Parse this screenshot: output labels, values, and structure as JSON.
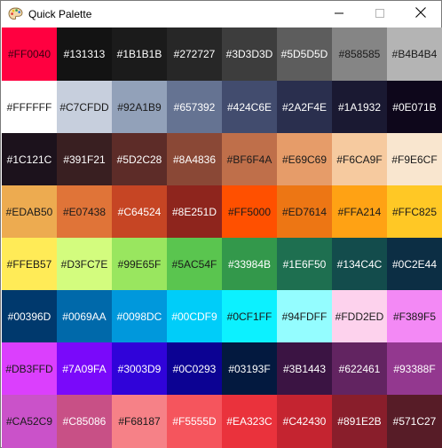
{
  "window": {
    "title": "Quick Palette",
    "app_icon": "palette-icon",
    "controls": [
      "minimize-icon",
      "maximize-icon",
      "close-icon"
    ]
  },
  "palette": {
    "swatches": [
      {
        "label": "#FF0040",
        "color": "#FF0040",
        "text": "#3a0010"
      },
      {
        "label": "#131313",
        "color": "#131313",
        "text": "#ffffff"
      },
      {
        "label": "#1B1B1B",
        "color": "#1B1B1B",
        "text": "#ffffff"
      },
      {
        "label": "#272727",
        "color": "#272727",
        "text": "#ffffff"
      },
      {
        "label": "#3D3D3D",
        "color": "#3D3D3D",
        "text": "#ffffff"
      },
      {
        "label": "#5D5D5D",
        "color": "#5D5D5D",
        "text": "#ffffff"
      },
      {
        "label": "#858585",
        "color": "#858585",
        "text": "#1a1a1a"
      },
      {
        "label": "#B4B4B4",
        "color": "#B4B4B4",
        "text": "#1a1a1a"
      },
      {
        "label": "#FFFFFF",
        "color": "#FFFFFF",
        "text": "#1a1a1a"
      },
      {
        "label": "#C7CFDD",
        "color": "#C7CFDD",
        "text": "#1a1a1a"
      },
      {
        "label": "#92A1B9",
        "color": "#92A1B9",
        "text": "#1a1a1a"
      },
      {
        "label": "#657392",
        "color": "#657392",
        "text": "#ffffff"
      },
      {
        "label": "#424C6E",
        "color": "#424C6E",
        "text": "#ffffff"
      },
      {
        "label": "#2A2F4E",
        "color": "#2A2F4E",
        "text": "#ffffff"
      },
      {
        "label": "#1A1932",
        "color": "#1A1932",
        "text": "#ffffff"
      },
      {
        "label": "#0E071B",
        "color": "#0E071B",
        "text": "#ffffff"
      },
      {
        "label": "#1C121C",
        "color": "#1C121C",
        "text": "#ffffff"
      },
      {
        "label": "#391F21",
        "color": "#391F21",
        "text": "#ffffff"
      },
      {
        "label": "#5D2C28",
        "color": "#5D2C28",
        "text": "#ffffff"
      },
      {
        "label": "#8A4836",
        "color": "#8A4836",
        "text": "#ffffff"
      },
      {
        "label": "#BF6F4A",
        "color": "#BF6F4A",
        "text": "#1a1a1a"
      },
      {
        "label": "#E69C69",
        "color": "#E69C69",
        "text": "#1a1a1a"
      },
      {
        "label": "#F6CA9F",
        "color": "#F6CA9F",
        "text": "#1a1a1a"
      },
      {
        "label": "#F9E6CF",
        "color": "#F9E6CF",
        "text": "#1a1a1a"
      },
      {
        "label": "#EDAB50",
        "color": "#EDAB50",
        "text": "#1a1a1a"
      },
      {
        "label": "#E07438",
        "color": "#E07438",
        "text": "#1a1a1a"
      },
      {
        "label": "#C64524",
        "color": "#C64524",
        "text": "#ffffff"
      },
      {
        "label": "#8E251D",
        "color": "#8E251D",
        "text": "#ffffff"
      },
      {
        "label": "#FF5000",
        "color": "#FF5000",
        "text": "#1a1a1a"
      },
      {
        "label": "#ED7614",
        "color": "#ED7614",
        "text": "#1a1a1a"
      },
      {
        "label": "#FFA214",
        "color": "#FFA214",
        "text": "#1a1a1a"
      },
      {
        "label": "#FFC825",
        "color": "#FFC825",
        "text": "#1a1a1a"
      },
      {
        "label": "#FFEB57",
        "color": "#FFEB57",
        "text": "#1a1a1a"
      },
      {
        "label": "#D3FC7E",
        "color": "#D3FC7E",
        "text": "#1a1a1a"
      },
      {
        "label": "#99E65F",
        "color": "#99E65F",
        "text": "#1a1a1a"
      },
      {
        "label": "#5AC54F",
        "color": "#5AC54F",
        "text": "#1a1a1a"
      },
      {
        "label": "#33984B",
        "color": "#33984B",
        "text": "#ffffff"
      },
      {
        "label": "#1E6F50",
        "color": "#1E6F50",
        "text": "#ffffff"
      },
      {
        "label": "#134C4C",
        "color": "#134C4C",
        "text": "#ffffff"
      },
      {
        "label": "#0C2E44",
        "color": "#0C2E44",
        "text": "#ffffff"
      },
      {
        "label": "#00396D",
        "color": "#00396D",
        "text": "#ffffff"
      },
      {
        "label": "#0069AA",
        "color": "#0069AA",
        "text": "#ffffff"
      },
      {
        "label": "#0098DC",
        "color": "#0098DC",
        "text": "#ffffff"
      },
      {
        "label": "#00CDF9",
        "color": "#00CDF9",
        "text": "#ffffff"
      },
      {
        "label": "#0CF1FF",
        "color": "#0CF1FF",
        "text": "#1a1a1a"
      },
      {
        "label": "#94FDFF",
        "color": "#94FDFF",
        "text": "#1a1a1a"
      },
      {
        "label": "#FDD2ED",
        "color": "#FDD2ED",
        "text": "#1a1a1a"
      },
      {
        "label": "#F389F5",
        "color": "#F389F5",
        "text": "#1a1a1a"
      },
      {
        "label": "#DB3FFD",
        "color": "#DB3FFD",
        "text": "#1a1a1a"
      },
      {
        "label": "#7A09FA",
        "color": "#7A09FA",
        "text": "#ffffff"
      },
      {
        "label": "#3003D9",
        "color": "#3003D9",
        "text": "#ffffff"
      },
      {
        "label": "#0C0293",
        "color": "#0C0293",
        "text": "#ffffff"
      },
      {
        "label": "#03193F",
        "color": "#03193F",
        "text": "#ffffff"
      },
      {
        "label": "#3B1443",
        "color": "#3B1443",
        "text": "#ffffff"
      },
      {
        "label": "#622461",
        "color": "#622461",
        "text": "#ffffff"
      },
      {
        "label": "#93388F",
        "color": "#93388F",
        "text": "#ffffff"
      },
      {
        "label": "#CA52C9",
        "color": "#CA52C9",
        "text": "#1a1a1a"
      },
      {
        "label": "#C85086",
        "color": "#C85086",
        "text": "#ffffff"
      },
      {
        "label": "#F68187",
        "color": "#F68187",
        "text": "#1a1a1a"
      },
      {
        "label": "#F5555D",
        "color": "#F5555D",
        "text": "#ffffff"
      },
      {
        "label": "#EA323C",
        "color": "#EA323C",
        "text": "#ffffff"
      },
      {
        "label": "#C42430",
        "color": "#C42430",
        "text": "#ffffff"
      },
      {
        "label": "#891E2B",
        "color": "#891E2B",
        "text": "#ffffff"
      },
      {
        "label": "#571C27",
        "color": "#571C27",
        "text": "#ffffff"
      }
    ]
  }
}
